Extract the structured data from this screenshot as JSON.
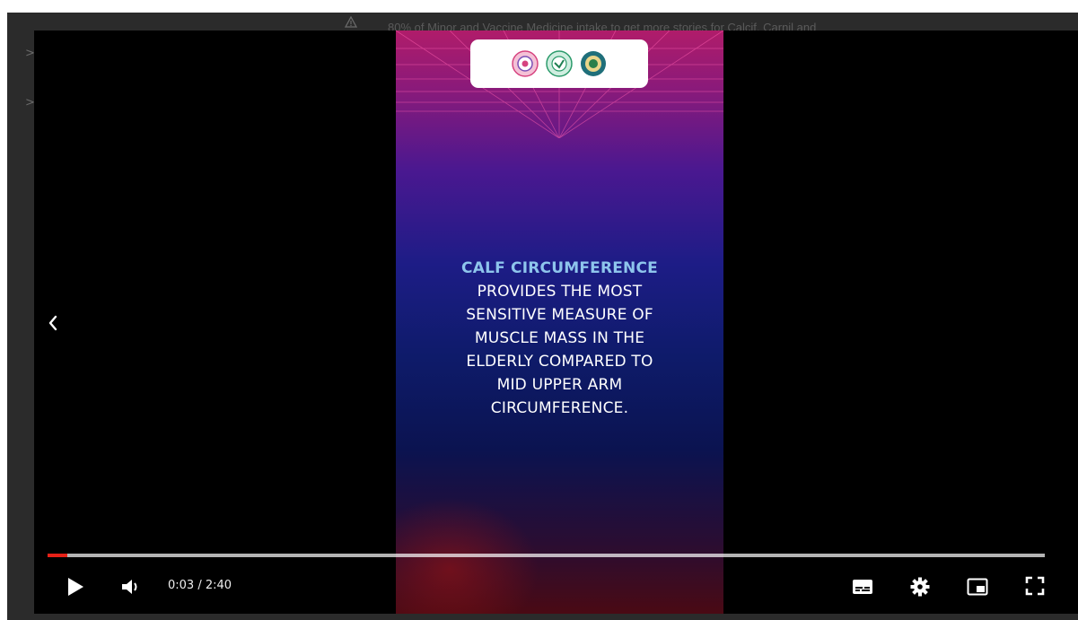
{
  "background_page": {
    "notice": "80% of Minor and Vaccine Medicine intake to get more stories for Calcif, Carnil and",
    "chevrons": [
      ">",
      ">"
    ]
  },
  "video": {
    "headline_highlight": "CALF CIRCUMFERENCE",
    "body_lines": [
      "PROVIDES THE MOST",
      "SENSITIVE MEASURE OF",
      "MUSCLE MASS IN THE",
      "ELDERLY COMPARED TO",
      "MID UPPER ARM",
      "CIRCUMFERENCE."
    ],
    "logos": [
      "logo-emblem-pink",
      "logo-emblem-green",
      "logo-emblem-teal"
    ]
  },
  "controls": {
    "current_time": "0:03",
    "duration": "2:40",
    "time_display": "0:03 / 2:40",
    "progress_fraction": 0.02,
    "buffered_fraction": 1.0,
    "icons": {
      "prev": "chevron-left-icon",
      "play": "play-icon",
      "volume": "volume-icon",
      "subtitles": "subtitles-icon",
      "settings": "gear-icon",
      "miniplayer": "miniplayer-icon",
      "fullscreen": "fullscreen-icon"
    }
  },
  "colors": {
    "progress": "#e62117",
    "highlight_text": "#8ec5ec",
    "player_bg": "#000000"
  }
}
